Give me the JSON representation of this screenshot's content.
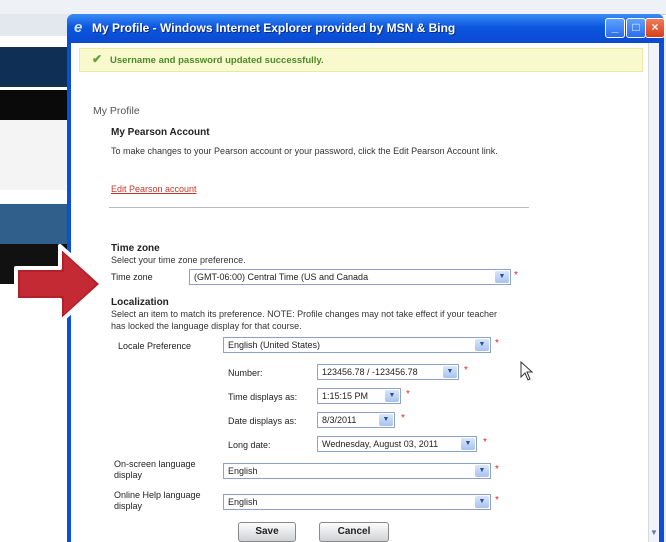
{
  "window": {
    "title": "My Profile - Windows Internet Explorer provided by MSN & Bing"
  },
  "banner": {
    "message": "Username and password updated successfully."
  },
  "page": {
    "title": "My Profile"
  },
  "pearson": {
    "heading": "My Pearson Account",
    "paragraph": "To make changes to your Pearson account or your password, click the Edit Pearson Account link.",
    "link": "Edit Pearson account"
  },
  "timezone": {
    "heading": "Time zone",
    "subtext": "Select your time zone preference.",
    "label": "Time zone",
    "value": "(GMT-06:00) Central Time (US and Canada"
  },
  "localization": {
    "heading": "Localization",
    "subtext": "Select an item to match its preference. NOTE: Profile changes may not take effect if your teacher has locked the language display for that course.",
    "locale_label": "Locale Preference",
    "locale_value": "English (United States)",
    "number_label": "Number:",
    "number_value": "123456.78 / -123456.78",
    "time_label": "Time displays as:",
    "time_value": "1:15:15 PM",
    "date_label": "Date displays as:",
    "date_value": "8/3/2011",
    "longdate_label": "Long date:",
    "longdate_value": "Wednesday, August 03, 2011",
    "onscreen_label": "On-screen language display",
    "onscreen_value": "English",
    "help_label": "Online Help language display",
    "help_value": "English"
  },
  "buttons": {
    "save": "Save",
    "cancel": "Cancel"
  },
  "required_marker": "*",
  "colors": {
    "titlebar": "#0c56df",
    "banner_bg": "#f8f9cc",
    "success": "#4c8a2a",
    "link": "#c0392b",
    "annotation_arrow": "#b3202a"
  }
}
